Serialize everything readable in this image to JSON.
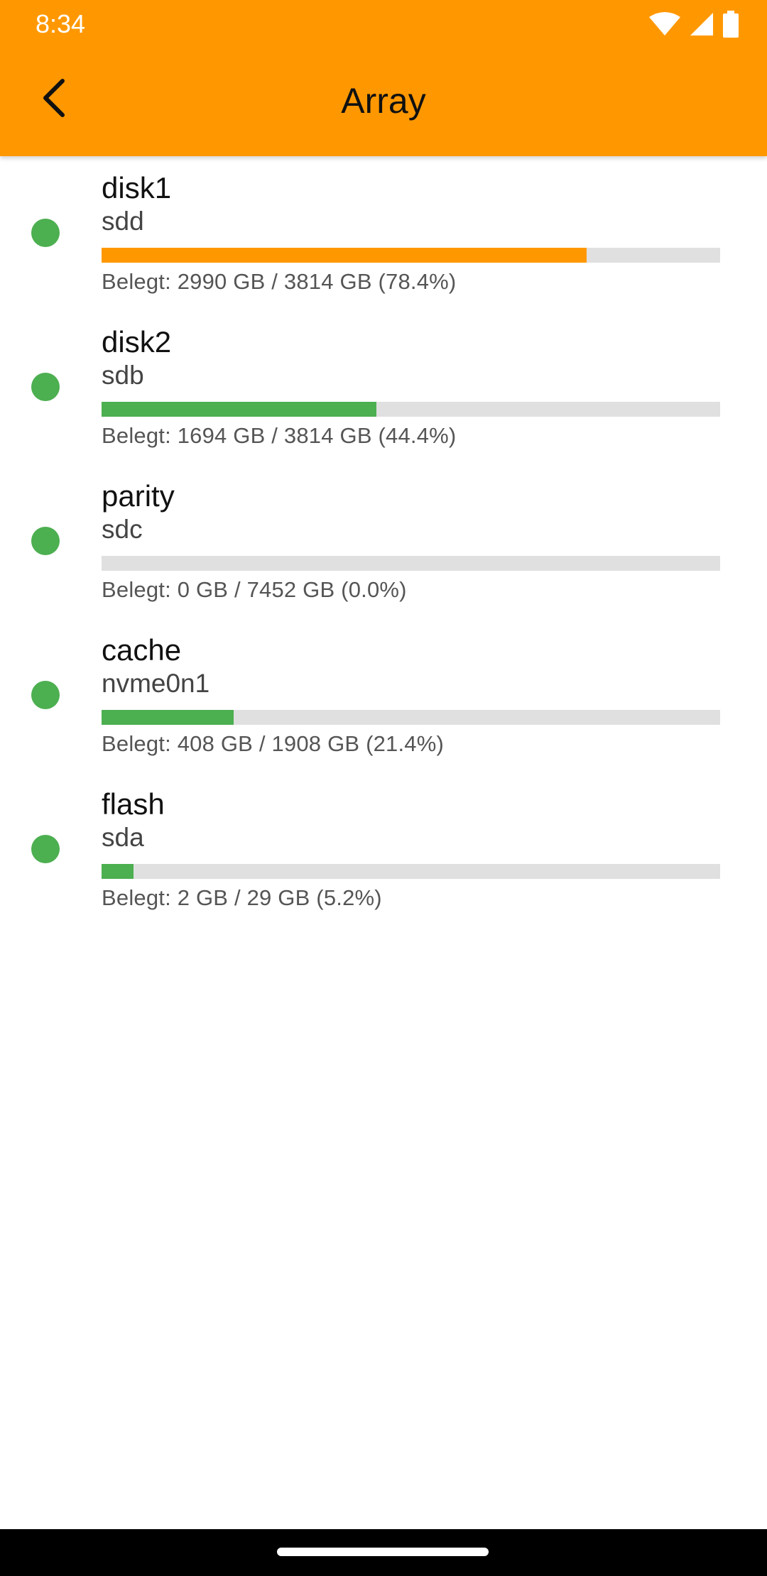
{
  "status_bar": {
    "time": "8:34",
    "icons": [
      "wifi-icon",
      "signal-icon",
      "battery-icon"
    ]
  },
  "app_bar": {
    "title": "Array",
    "back_icon": "arrow-back-icon",
    "color": "#FF9800"
  },
  "colors": {
    "ok": "#4CAF50",
    "warning": "#FF9800",
    "track": "#E0E0E0"
  },
  "disks": [
    {
      "name": "disk1",
      "device": "sdd",
      "usage_text": "Belegt: 2990 GB / 3814 GB (78.4%)",
      "percent": 78.4,
      "bar_color": "#FF9800",
      "status_color": "#4CAF50"
    },
    {
      "name": "disk2",
      "device": "sdb",
      "usage_text": "Belegt: 1694 GB / 3814 GB (44.4%)",
      "percent": 44.4,
      "bar_color": "#4CAF50",
      "status_color": "#4CAF50"
    },
    {
      "name": "parity",
      "device": "sdc",
      "usage_text": "Belegt: 0 GB / 7452 GB (0.0%)",
      "percent": 0.0,
      "bar_color": "#4CAF50",
      "status_color": "#4CAF50"
    },
    {
      "name": "cache",
      "device": "nvme0n1",
      "usage_text": "Belegt: 408 GB / 1908 GB (21.4%)",
      "percent": 21.4,
      "bar_color": "#4CAF50",
      "status_color": "#4CAF50"
    },
    {
      "name": "flash",
      "device": "sda",
      "usage_text": "Belegt: 2 GB / 29 GB (5.2%)",
      "percent": 5.2,
      "bar_color": "#4CAF50",
      "status_color": "#4CAF50"
    }
  ]
}
